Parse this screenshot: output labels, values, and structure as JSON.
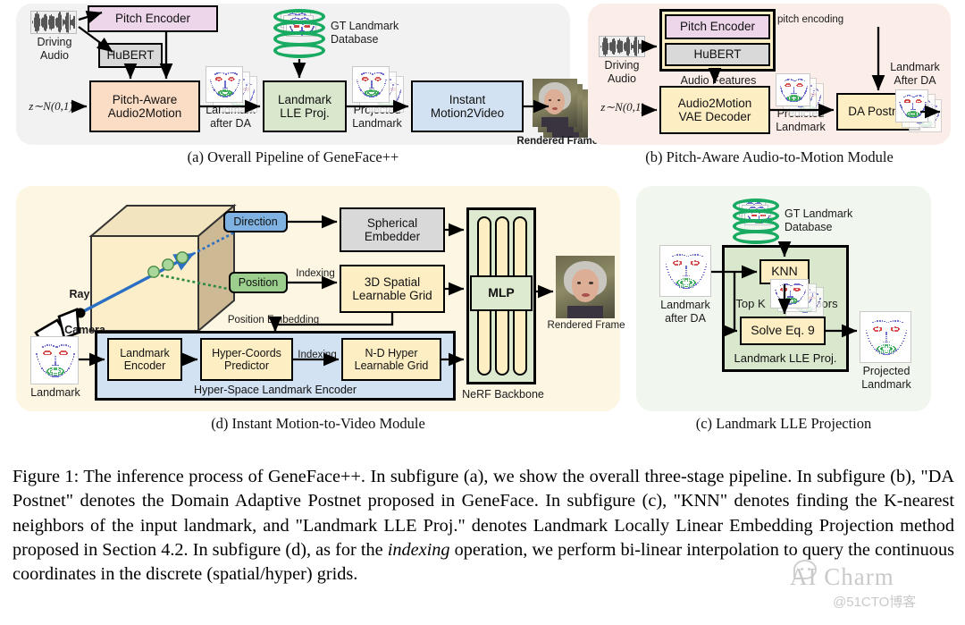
{
  "figure": {
    "caption_label": "Figure 1:",
    "caption_text": "The inference process of GeneFace++. In subfigure (a), we show the overall three-stage pipeline. In subfigure (b), \"DA Postnet\" denotes the Domain Adaptive Postnet proposed in GeneFace. In subfigure (c), \"KNN\" denotes finding the K-nearest neighbors of the input landmark, and \"Landmark LLE Proj.\" denotes Landmark Locally Linear Embedding Projection method proposed in Section 4.2. In subfigure (d), as for the ",
    "caption_italic": "indexing",
    "caption_text2": " operation, we perform bi-linear interpolation to query the continuous coordinates in the discrete (spatial/hyper) grids."
  },
  "subcaptions": {
    "a": "(a) Overall Pipeline of GeneFace++",
    "b": "(b) Pitch-Aware Audio-to-Motion Module",
    "c": "(c) Landmark LLE Projection",
    "d": "(d) Instant Motion-to-Video Module"
  },
  "panel_a": {
    "driving_audio": "Driving\nAudio",
    "pitch_encoder": "Pitch Encoder",
    "hubert": "HuBERT",
    "noise": "z∼N(0,1)",
    "audio2motion": "Pitch-Aware\nAudio2Motion",
    "landmark_after_da": "Landmark\nafter DA",
    "gt_db": "GT Landmark\nDatabase",
    "lle_proj": "Landmark\nLLE Proj.",
    "projected_landmark": "Projected\nLandmark",
    "motion2video": "Instant\nMotion2Video",
    "rendered_frames": "Rendered Frames"
  },
  "panel_b": {
    "driving_audio": "Driving\nAudio",
    "pitch_encoder": "Pitch Encoder",
    "hubert": "HuBERT",
    "pitch_encoding": "pitch encoding",
    "audio_features": "Audio  Features",
    "noise": "z∼N(0,1)",
    "vae_decoder": "Audio2Motion\nVAE Decoder",
    "predicted_landmark": "Predicted\nLandmark",
    "da_postnet": "DA Postnet",
    "landmark_after_da": "Landmark\nAfter DA"
  },
  "panel_c": {
    "gt_db": "GT Landmark\nDatabase",
    "landmark_after_da": "Landmark\nafter DA",
    "knn": "KNN",
    "topk": "Top K",
    "neighbors": "Neighbors",
    "solve_eq": "Solve Eq. 9",
    "group_title": "Landmark LLE Proj.",
    "projected_landmark": "Projected\nLandmark"
  },
  "panel_d": {
    "ray": "Ray",
    "camera": "Camera",
    "direction": "Direction",
    "position": "Position",
    "indexing_1": "Indexing",
    "spherical_embedder": "Spherical\nEmbedder",
    "spatial_grid": "3D Spatial\nLearnable Grid",
    "position_embedding": "Position Embedding",
    "landmark": "Landmark",
    "landmark_encoder": "Landmark\nEncoder",
    "hyper_coords": "Hyper-Coords\nPredictor",
    "indexing_2": "Indexing",
    "hyper_grid": "N-D Hyper\nLearnable Grid",
    "hyper_space_title": "Hyper-Space Landmark Encoder",
    "mlp": "MLP",
    "nerf_backbone": "NeRF Backbone",
    "rendered_frame": "Rendered Frame"
  },
  "watermark": {
    "main": "AI Charm",
    "sub": "@51CTO博客"
  },
  "colors": {
    "panel_a_bg": "#f2f2f2",
    "panel_b_bg": "#fbeee8",
    "panel_c_bg": "#f1f6ef",
    "panel_d_bg": "#fdf6e3",
    "pitch_encoder": "#eed6ea",
    "hubert": "#d9d9d9",
    "audio2motion": "#fbdcc4",
    "lle_proj": "#d9e8cd",
    "motion2video": "#d3e2f2",
    "yellow_box": "#fdeec4",
    "direction_blue": "#7fb2e0",
    "position_green": "#9ccf8e",
    "database_green": "#1aab62",
    "hyper_space_bg": "#d3e2f2",
    "nerf_bg": "#ddeacf"
  }
}
